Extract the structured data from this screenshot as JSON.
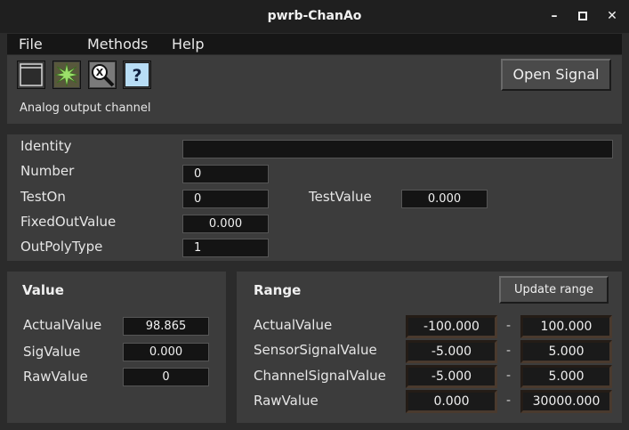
{
  "window": {
    "title": "pwrb-ChanAo",
    "minimize": "–",
    "maximize": "▪",
    "close": "✕"
  },
  "menu": {
    "file": "File",
    "methods": "Methods",
    "help": "Help"
  },
  "toolbar": {
    "icons": [
      "window-icon",
      "signal-star-icon",
      "search-cross-icon",
      "help-icon"
    ],
    "subtitle": "Analog output channel",
    "open_signal": "Open Signal"
  },
  "attributes": {
    "identity": {
      "label": "Identity",
      "value": ""
    },
    "number": {
      "label": "Number",
      "value": "0"
    },
    "teston": {
      "label": "TestOn",
      "value": "0"
    },
    "testvalue": {
      "label": "TestValue",
      "value": "0.000"
    },
    "fixedout": {
      "label": "FixedOutValue",
      "value": "0.000"
    },
    "outpoly": {
      "label": "OutPolyType",
      "value": "1"
    }
  },
  "value_panel": {
    "heading": "Value",
    "actual": {
      "label": "ActualValue",
      "value": "98.865"
    },
    "sig": {
      "label": "SigValue",
      "value": "0.000"
    },
    "raw": {
      "label": "RawValue",
      "value": "0"
    }
  },
  "range_panel": {
    "heading": "Range",
    "update_button": "Update range",
    "separator": "-",
    "actual": {
      "label": "ActualValue",
      "min": "-100.000",
      "max": "100.000"
    },
    "sensor": {
      "label": "SensorSignalValue",
      "min": "-5.000",
      "max": "5.000"
    },
    "channel": {
      "label": "ChannelSignalValue",
      "min": "-5.000",
      "max": "5.000"
    },
    "raw": {
      "label": "RawValue",
      "min": "0.000",
      "max": "30000.000"
    }
  }
}
